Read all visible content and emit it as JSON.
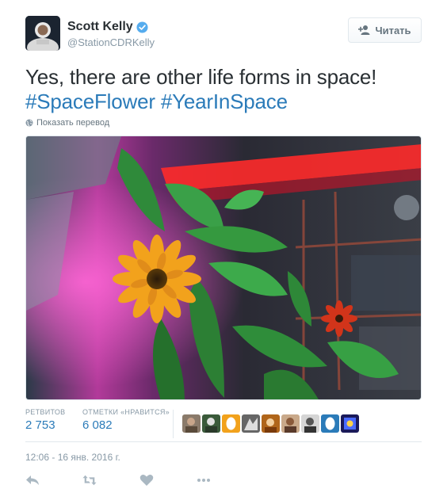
{
  "author": {
    "display_name": "Scott Kelly",
    "handle": "@StationCDRKelly",
    "verified": true
  },
  "follow_button": {
    "label": "Читать"
  },
  "tweet": {
    "text_main": "Yes, there are other life forms in space!",
    "hashtags": [
      "#SpaceFlower",
      "#YearInSpace"
    ]
  },
  "translate_link": "Показать перевод",
  "stats": {
    "retweets_label": "РЕТВИТОВ",
    "retweets_value": "2 753",
    "likes_label": "ОТМЕТКИ «НРАВИТСЯ»",
    "likes_value": "6 082"
  },
  "timestamp": "12:06 - 16 янв. 2016 г.",
  "actions": [
    "reply-icon",
    "retweet-icon",
    "like-icon",
    "more-icon"
  ],
  "colors": {
    "hashtag": "#2b7bb9",
    "muted": "#8899a6",
    "text": "#292f33",
    "verified": "#55acee"
  }
}
